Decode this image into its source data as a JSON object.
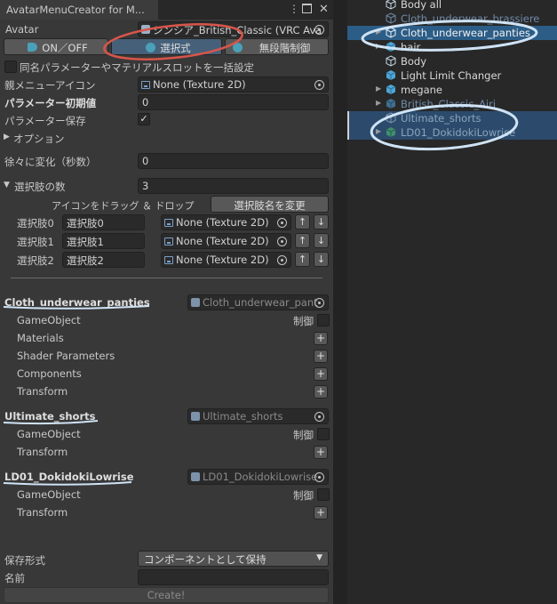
{
  "window": {
    "tab_title": "AvatarMenuCreator for M...",
    "menu_icon": "kebab-menu-icon",
    "maximize_icon": "maximize-icon",
    "close_icon": "close-icon"
  },
  "avatar": {
    "label": "Avatar",
    "value": "シンシア_British_Classic (VRC Ava"
  },
  "mode_buttons": [
    {
      "label": "ON／OFF",
      "selected": false
    },
    {
      "label": "選択式",
      "selected": true
    },
    {
      "label": "無段階制御",
      "selected": false
    }
  ],
  "same_param_label": "同名パラメーターやマテリアルスロットを一括設定",
  "parent_menu_icon": {
    "label": "親メニューアイコン",
    "value": "None (Texture 2D)"
  },
  "param_initial": {
    "label": "パラメーター初期値",
    "value": "0"
  },
  "param_save": {
    "label": "パラメーター保存",
    "checked": true
  },
  "options_label": "オプション",
  "gradual": {
    "label": "徐々に変化（秒数）",
    "value": "0"
  },
  "choice_count": {
    "label": "選択肢の数",
    "value": "3"
  },
  "drag_drop_label": "アイコンをドラッグ ＆ ドロップ",
  "rename_button": "選択肢名を変更",
  "choices": [
    {
      "label": "選択肢0",
      "name": "選択肢0",
      "texture": "None (Texture 2D)"
    },
    {
      "label": "選択肢1",
      "name": "選択肢1",
      "texture": "None (Texture 2D)"
    },
    {
      "label": "選択肢2",
      "name": "選択肢2",
      "texture": "None (Texture 2D)"
    }
  ],
  "arrow_up": "↑",
  "arrow_down": "↓",
  "objects": [
    {
      "name": "Cloth_underwear_panties",
      "field": "Cloth_underwear_pant",
      "rows": [
        "GameObject",
        "Materials",
        "Shader Parameters",
        "Components",
        "Transform"
      ],
      "control_label": "制御"
    },
    {
      "name": "Ultimate_shorts",
      "field": "Ultimate_shorts",
      "rows": [
        "GameObject",
        "Transform"
      ],
      "control_label": "制御"
    },
    {
      "name": "LD01_DokidokiLowrise",
      "field": "LD01_DokidokiLowrise",
      "rows": [
        "GameObject",
        "Transform"
      ],
      "control_label": "制御"
    }
  ],
  "save_format": {
    "label": "保存形式",
    "value": "コンポーネントとして保持"
  },
  "name_field": {
    "label": "名前",
    "value": ""
  },
  "create_button": "Create!",
  "hierarchy": [
    {
      "name": "Body all",
      "expand": false,
      "selected": false,
      "faded": false
    },
    {
      "name": "Cloth_underwear_brassiere",
      "expand": false,
      "selected": false,
      "faded": true
    },
    {
      "name": "Cloth_underwear_panties",
      "expand": true,
      "selected": true,
      "faded": false
    },
    {
      "name": "hair",
      "expand": true,
      "selected": false,
      "faded": false
    },
    {
      "name": "Body",
      "expand": false,
      "selected": false,
      "faded": false
    },
    {
      "name": "Light Limit Changer",
      "expand": false,
      "selected": false,
      "faded": false
    },
    {
      "name": "megane",
      "expand": true,
      "selected": false,
      "faded": false
    },
    {
      "name": "British_Classic_Airi",
      "expand": true,
      "selected": false,
      "faded": true
    },
    {
      "name": "Ultimate_shorts",
      "expand": false,
      "selected": true,
      "faded": true
    },
    {
      "name": "LD01_DokidokiLowrise",
      "expand": true,
      "selected": true,
      "faded": true
    }
  ],
  "colors": {
    "accent": "#2c5d87",
    "annotation_red": "#d8554a",
    "annotation_blue": "#cfe3f5"
  }
}
